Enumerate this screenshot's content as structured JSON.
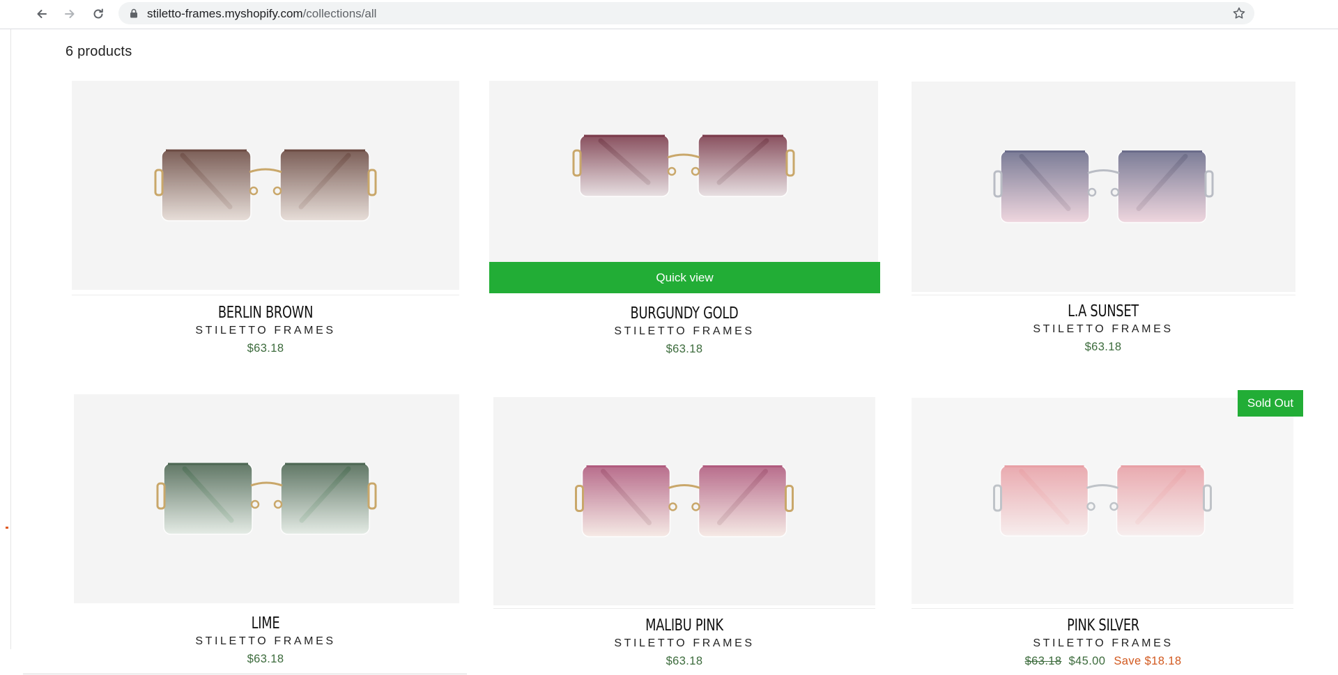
{
  "browser": {
    "url_host": "stiletto-frames.myshopify.com",
    "url_path": "/collections/all"
  },
  "collection": {
    "count_label": "6 products"
  },
  "colors": {
    "accent_green": "#22ad36",
    "price_green": "#3c6b3c",
    "sale_orange": "#d2591f"
  },
  "products": [
    {
      "title": "BERLIN BROWN",
      "vendor": "STILETTO FRAMES",
      "price": "$63.18",
      "lens_top": "#6b4a42",
      "lens_bottom": "#e6dcd6",
      "temple": "#6a4a44",
      "metal": "#c9a76a"
    },
    {
      "title": "BURGUNDY GOLD",
      "vendor": "STILETTO FRAMES",
      "price": "$63.18",
      "quick_view": "Quick view",
      "lens_top": "#7a3a4a",
      "lens_bottom": "#e6dde0",
      "temple": "#4a3034",
      "metal": "#c9a76a"
    },
    {
      "title": "L.A SUNSET",
      "vendor": "STILETTO FRAMES",
      "price": "$63.18",
      "lens_top": "#6a6c8a",
      "lens_bottom": "#efd3dc",
      "temple": "#4d4a52",
      "metal": "#b9bcc4"
    },
    {
      "title": "LIME",
      "vendor": "STILETTO FRAMES",
      "price": "$63.18",
      "lens_top": "#4c6652",
      "lens_bottom": "#e3ebe4",
      "temple": "#3f8a52",
      "metal": "#c9a76a"
    },
    {
      "title": "MALIBU PINK",
      "vendor": "STILETTO FRAMES",
      "price": "$63.18",
      "lens_top": "#b05b7e",
      "lens_bottom": "#f6e9e4",
      "temple": "#5a3a40",
      "metal": "#c9a76a"
    },
    {
      "title": "PINK SILVER",
      "vendor": "STILETTO FRAMES",
      "price_old": "$63.18",
      "price_new": "$45.00",
      "save": "Save $18.18",
      "badge": "Sold Out",
      "lens_top": "#e8a0a6",
      "lens_bottom": "#f7eded",
      "temple": "#f0a9a6",
      "metal": "#bfc3c8"
    }
  ]
}
